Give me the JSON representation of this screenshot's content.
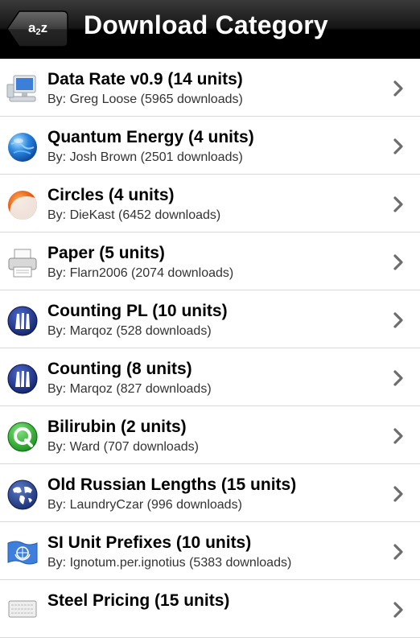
{
  "navbar": {
    "back_label_main": "a",
    "back_label_sub": "2",
    "back_label_end": "z",
    "title": "Download Category"
  },
  "items": [
    {
      "title": "Data Rate v0.9 (14 units)",
      "subtitle": "By: Greg Loose (5965 downloads)",
      "icon": "computer-monitor-icon"
    },
    {
      "title": "Quantum Energy (4 units)",
      "subtitle": "By: Josh Brown (2501 downloads)",
      "icon": "blue-globe-icon"
    },
    {
      "title": "Circles (4 units)",
      "subtitle": "By: DieKast (6452 downloads)",
      "icon": "orange-circle-icon"
    },
    {
      "title": "Paper (5 units)",
      "subtitle": "By: Flarn2006 (2074 downloads)",
      "icon": "printer-icon"
    },
    {
      "title": "Counting PL (10 units)",
      "subtitle": "By: Marqoz (528 downloads)",
      "icon": "counting-badge-icon"
    },
    {
      "title": "Counting (8 units)",
      "subtitle": "By: Marqoz (827 downloads)",
      "icon": "counting-badge-icon"
    },
    {
      "title": "Bilirubin (2 units)",
      "subtitle": "By: Ward (707 downloads)",
      "icon": "green-q-icon"
    },
    {
      "title": "Old Russian Lengths (15 units)",
      "subtitle": "By: LaundryCzar (996 downloads)",
      "icon": "world-map-globe-icon"
    },
    {
      "title": "SI Unit Prefixes (10 units)",
      "subtitle": "By: Ignotum.per.ignotius (5383 downloads)",
      "icon": "un-flag-icon"
    },
    {
      "title": "Steel Pricing (15 units)",
      "subtitle": "",
      "icon": "keyboard-icon"
    }
  ]
}
